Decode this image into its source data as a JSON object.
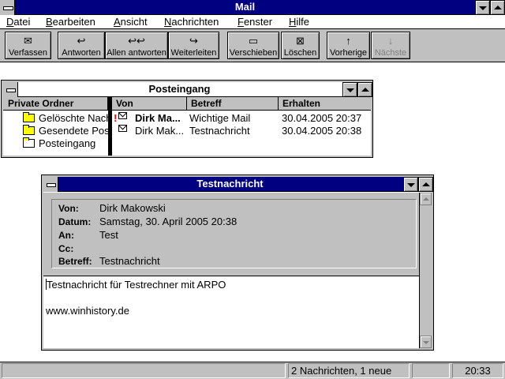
{
  "app": {
    "title": "Mail"
  },
  "menu": [
    {
      "label": "Datei",
      "accel": "D",
      "rest": "atei"
    },
    {
      "label": "Bearbeiten",
      "accel": "B",
      "rest": "earbeiten"
    },
    {
      "label": "Ansicht",
      "accel": "A",
      "rest": "nsicht"
    },
    {
      "label": "Nachrichten",
      "accel": "N",
      "rest": "achrichten"
    },
    {
      "label": "Fenster",
      "accel": "F",
      "rest": "enster"
    },
    {
      "label": "Hilfe",
      "accel": "H",
      "rest": "ilfe"
    }
  ],
  "toolbar": {
    "compose": "Verfassen",
    "reply": "Antworten",
    "reply_all": "Allen antworten",
    "forward": "Weiterleiten",
    "move": "Verschieben",
    "delete": "Löschen",
    "previous": "Vorherige",
    "next": "Nächste"
  },
  "inbox": {
    "title": "Posteingang",
    "folders_header": "Private Ordner",
    "folders": [
      "Gelöschte Nachrichten",
      "Gesendete Post",
      "Posteingang"
    ],
    "columns": [
      "Von",
      "Betreff",
      "Erhalten"
    ],
    "messages": [
      {
        "from": "Dirk Ma...",
        "subject": "Wichtige Mail",
        "received": "30.04.2005 20:37",
        "flag": "!"
      },
      {
        "from": "Dirk Mak...",
        "subject": "Testnachricht",
        "received": "30.04.2005 20:38",
        "flag": ""
      }
    ]
  },
  "message": {
    "title": "Testnachricht",
    "labels": {
      "from": "Von:",
      "date": "Datum:",
      "to": "An:",
      "cc": "Cc:",
      "subject": "Betreff:"
    },
    "from": "Dirk Makowski",
    "date": "Samstag, 30. April 2005 20:38",
    "to": "Test",
    "cc": "",
    "subject": "Testnachricht",
    "body_line1": "Testnachricht für Testrechner mit ARPO",
    "body_line2": "www.winhistory.de"
  },
  "status": {
    "summary": "2 Nachrichten, 1 neue",
    "time": "20:33"
  },
  "colors": {
    "titlebar_active": "#000080",
    "face": "#c0c0c0",
    "folder": "#ffff00",
    "flag": "#ff0000"
  }
}
